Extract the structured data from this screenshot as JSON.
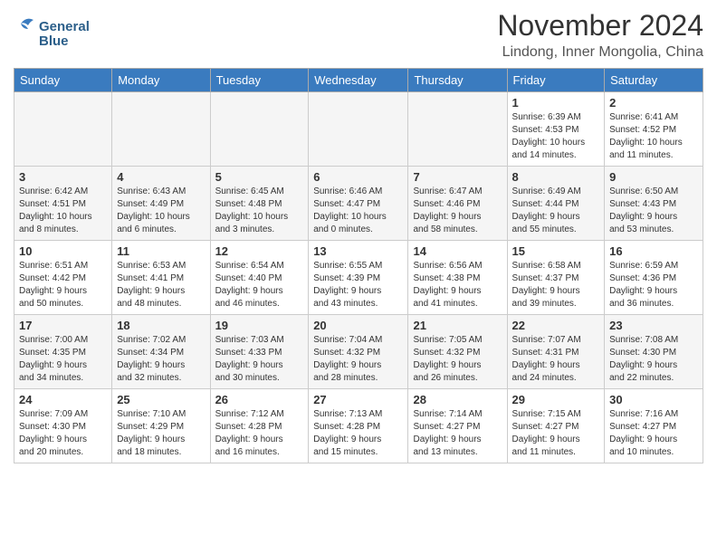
{
  "header": {
    "logo_line1": "General",
    "logo_line2": "Blue",
    "month": "November 2024",
    "location": "Lindong, Inner Mongolia, China"
  },
  "weekdays": [
    "Sunday",
    "Monday",
    "Tuesday",
    "Wednesday",
    "Thursday",
    "Friday",
    "Saturday"
  ],
  "weeks": [
    [
      {
        "day": "",
        "info": ""
      },
      {
        "day": "",
        "info": ""
      },
      {
        "day": "",
        "info": ""
      },
      {
        "day": "",
        "info": ""
      },
      {
        "day": "",
        "info": ""
      },
      {
        "day": "1",
        "info": "Sunrise: 6:39 AM\nSunset: 4:53 PM\nDaylight: 10 hours\nand 14 minutes."
      },
      {
        "day": "2",
        "info": "Sunrise: 6:41 AM\nSunset: 4:52 PM\nDaylight: 10 hours\nand 11 minutes."
      }
    ],
    [
      {
        "day": "3",
        "info": "Sunrise: 6:42 AM\nSunset: 4:51 PM\nDaylight: 10 hours\nand 8 minutes."
      },
      {
        "day": "4",
        "info": "Sunrise: 6:43 AM\nSunset: 4:49 PM\nDaylight: 10 hours\nand 6 minutes."
      },
      {
        "day": "5",
        "info": "Sunrise: 6:45 AM\nSunset: 4:48 PM\nDaylight: 10 hours\nand 3 minutes."
      },
      {
        "day": "6",
        "info": "Sunrise: 6:46 AM\nSunset: 4:47 PM\nDaylight: 10 hours\nand 0 minutes."
      },
      {
        "day": "7",
        "info": "Sunrise: 6:47 AM\nSunset: 4:46 PM\nDaylight: 9 hours\nand 58 minutes."
      },
      {
        "day": "8",
        "info": "Sunrise: 6:49 AM\nSunset: 4:44 PM\nDaylight: 9 hours\nand 55 minutes."
      },
      {
        "day": "9",
        "info": "Sunrise: 6:50 AM\nSunset: 4:43 PM\nDaylight: 9 hours\nand 53 minutes."
      }
    ],
    [
      {
        "day": "10",
        "info": "Sunrise: 6:51 AM\nSunset: 4:42 PM\nDaylight: 9 hours\nand 50 minutes."
      },
      {
        "day": "11",
        "info": "Sunrise: 6:53 AM\nSunset: 4:41 PM\nDaylight: 9 hours\nand 48 minutes."
      },
      {
        "day": "12",
        "info": "Sunrise: 6:54 AM\nSunset: 4:40 PM\nDaylight: 9 hours\nand 46 minutes."
      },
      {
        "day": "13",
        "info": "Sunrise: 6:55 AM\nSunset: 4:39 PM\nDaylight: 9 hours\nand 43 minutes."
      },
      {
        "day": "14",
        "info": "Sunrise: 6:56 AM\nSunset: 4:38 PM\nDaylight: 9 hours\nand 41 minutes."
      },
      {
        "day": "15",
        "info": "Sunrise: 6:58 AM\nSunset: 4:37 PM\nDaylight: 9 hours\nand 39 minutes."
      },
      {
        "day": "16",
        "info": "Sunrise: 6:59 AM\nSunset: 4:36 PM\nDaylight: 9 hours\nand 36 minutes."
      }
    ],
    [
      {
        "day": "17",
        "info": "Sunrise: 7:00 AM\nSunset: 4:35 PM\nDaylight: 9 hours\nand 34 minutes."
      },
      {
        "day": "18",
        "info": "Sunrise: 7:02 AM\nSunset: 4:34 PM\nDaylight: 9 hours\nand 32 minutes."
      },
      {
        "day": "19",
        "info": "Sunrise: 7:03 AM\nSunset: 4:33 PM\nDaylight: 9 hours\nand 30 minutes."
      },
      {
        "day": "20",
        "info": "Sunrise: 7:04 AM\nSunset: 4:32 PM\nDaylight: 9 hours\nand 28 minutes."
      },
      {
        "day": "21",
        "info": "Sunrise: 7:05 AM\nSunset: 4:32 PM\nDaylight: 9 hours\nand 26 minutes."
      },
      {
        "day": "22",
        "info": "Sunrise: 7:07 AM\nSunset: 4:31 PM\nDaylight: 9 hours\nand 24 minutes."
      },
      {
        "day": "23",
        "info": "Sunrise: 7:08 AM\nSunset: 4:30 PM\nDaylight: 9 hours\nand 22 minutes."
      }
    ],
    [
      {
        "day": "24",
        "info": "Sunrise: 7:09 AM\nSunset: 4:30 PM\nDaylight: 9 hours\nand 20 minutes."
      },
      {
        "day": "25",
        "info": "Sunrise: 7:10 AM\nSunset: 4:29 PM\nDaylight: 9 hours\nand 18 minutes."
      },
      {
        "day": "26",
        "info": "Sunrise: 7:12 AM\nSunset: 4:28 PM\nDaylight: 9 hours\nand 16 minutes."
      },
      {
        "day": "27",
        "info": "Sunrise: 7:13 AM\nSunset: 4:28 PM\nDaylight: 9 hours\nand 15 minutes."
      },
      {
        "day": "28",
        "info": "Sunrise: 7:14 AM\nSunset: 4:27 PM\nDaylight: 9 hours\nand 13 minutes."
      },
      {
        "day": "29",
        "info": "Sunrise: 7:15 AM\nSunset: 4:27 PM\nDaylight: 9 hours\nand 11 minutes."
      },
      {
        "day": "30",
        "info": "Sunrise: 7:16 AM\nSunset: 4:27 PM\nDaylight: 9 hours\nand 10 minutes."
      }
    ]
  ]
}
